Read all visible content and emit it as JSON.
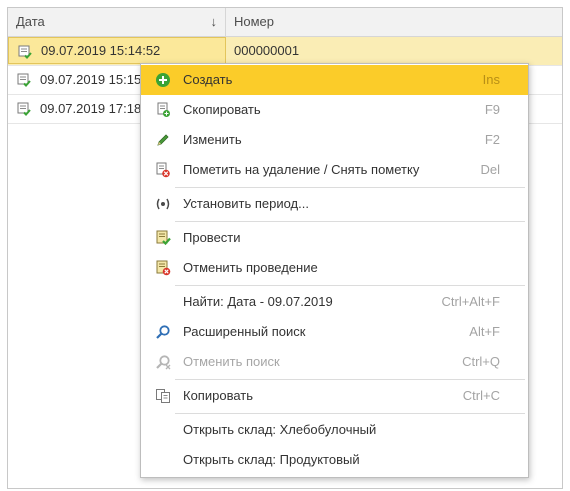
{
  "columns": {
    "date": "Дата",
    "number": "Номер",
    "sort_indicator": "↓"
  },
  "rows": [
    {
      "date": "09.07.2019 15:14:52",
      "number": "000000001",
      "selected": true,
      "icon": "posted-document-icon"
    },
    {
      "date": "09.07.2019 15:15",
      "number": "",
      "selected": false,
      "icon": "posted-document-icon"
    },
    {
      "date": "09.07.2019 17:18",
      "number": "",
      "selected": false,
      "icon": "posted-document-icon"
    }
  ],
  "context_menu": {
    "items": [
      {
        "label": "Создать",
        "shortcut": "Ins",
        "icon": "add-circle-icon",
        "active": true
      },
      {
        "label": "Скопировать",
        "shortcut": "F9",
        "icon": "copy-document-icon"
      },
      {
        "label": "Изменить",
        "shortcut": "F2",
        "icon": "pencil-icon"
      },
      {
        "label": "Пометить на удаление / Снять пометку",
        "shortcut": "Del",
        "icon": "delete-mark-icon"
      },
      {
        "label": "Установить период...",
        "shortcut": "",
        "icon": "period-icon"
      },
      {
        "label": "Провести",
        "shortcut": "",
        "icon": "post-document-icon"
      },
      {
        "label": "Отменить проведение",
        "shortcut": "",
        "icon": "unpost-document-icon"
      },
      {
        "label": "Найти: Дата - 09.07.2019",
        "shortcut": "Ctrl+Alt+F",
        "icon": ""
      },
      {
        "label": "Расширенный поиск",
        "shortcut": "Alt+F",
        "icon": "search-icon"
      },
      {
        "label": "Отменить поиск",
        "shortcut": "Ctrl+Q",
        "icon": "cancel-search-icon",
        "disabled": true
      },
      {
        "label": "Копировать",
        "shortcut": "Ctrl+C",
        "icon": "clipboard-copy-icon"
      },
      {
        "label": "Открыть склад: Хлебобулочный",
        "shortcut": "",
        "icon": ""
      },
      {
        "label": "Открыть склад: Продуктовый",
        "shortcut": "",
        "icon": ""
      }
    ]
  },
  "colors": {
    "menu_highlight": "#fbcc29",
    "selected_row": "#faedb5",
    "shortcut_text": "#a3a3a3"
  }
}
